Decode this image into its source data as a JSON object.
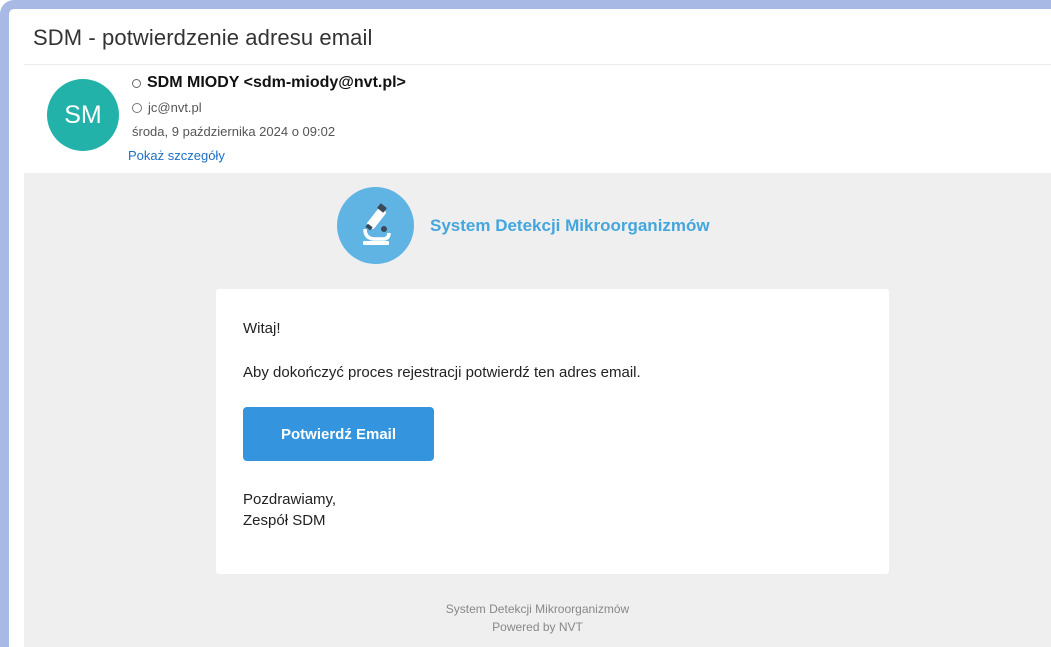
{
  "email": {
    "subject": "SDM - potwierdzenie adresu email",
    "avatar_initials": "SM",
    "avatar_color": "#22b2a9",
    "from": "SDM MIODY <sdm-miody@nvt.pl>",
    "to": "jc@nvt.pl",
    "date": "środa, 9 października 2024 o 09:02",
    "details_link": "Pokaż szczegóły"
  },
  "body": {
    "brand_name": "System Detekcji Mikroorganizmów",
    "brand_color": "#45a6de",
    "logo_icon": "microscope-icon",
    "greeting": "Witaj!",
    "message": "Aby dokończyć proces rejestracji potwierdź ten adres email.",
    "button_label": "Potwierdź Email",
    "button_color": "#3494dd",
    "signoff_line1": "Pozdrawiamy,",
    "signoff_line2": "Zespół SDM",
    "footer_line1": "System Detekcji Mikroorganizmów",
    "footer_line2": "Powered by NVT"
  }
}
